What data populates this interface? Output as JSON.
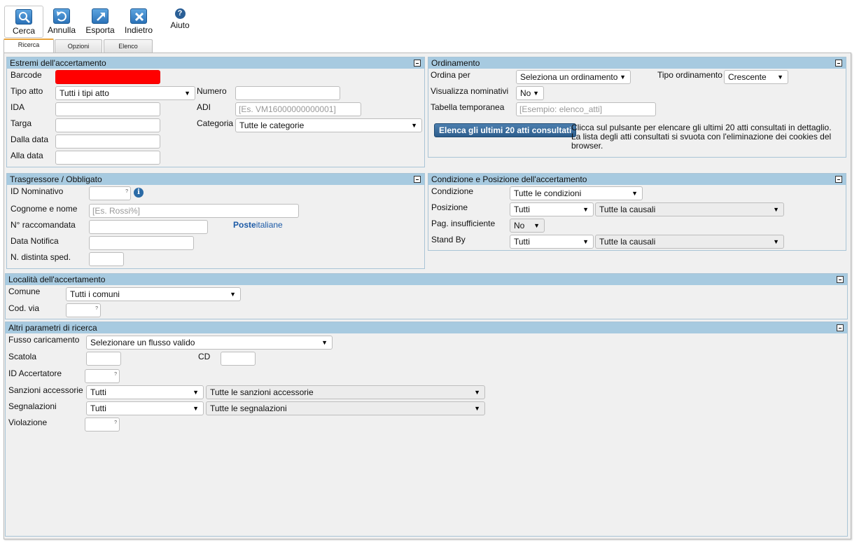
{
  "toolbar": {
    "cerca": "Cerca",
    "annulla": "Annulla",
    "esporta": "Esporta",
    "indietro": "Indietro",
    "aiuto": "Aiuto",
    "help_glyph": "?"
  },
  "tabs": [
    "Ricerca",
    "Opzioni",
    "Elenco"
  ],
  "estremi": {
    "title": "Estremi dell'accertamento",
    "barcode_label": "Barcode",
    "tipo_atto_label": "Tipo atto",
    "tipo_atto_value": "Tutti i tipi atto",
    "numero_label": "Numero",
    "ida_label": "IDA",
    "adi_label": "ADI",
    "adi_placeholder": "[Es. VM16000000000001]",
    "targa_label": "Targa",
    "categoria_label": "Categoria",
    "categoria_value": "Tutte le categorie",
    "dalla_data_label": "Dalla data",
    "alla_data_label": "Alla data"
  },
  "ordinamento": {
    "title": "Ordinamento",
    "ordina_per_label": "Ordina per",
    "ordina_per_value": "Seleziona un ordinamento",
    "tipo_ordinamento_label": "Tipo ordinamento",
    "tipo_ordinamento_value": "Crescente",
    "visualizza_label": "Visualizza nominativi",
    "visualizza_value": "No",
    "tabella_label": "Tabella temporanea",
    "tabella_placeholder": "[Esempio: elenco_atti]",
    "elenca_button": "Elenca gli ultimi 20 atti consultati",
    "elenca_note": "Clicca sul pulsante per elencare gli ultimi 20 atti consultati in dettaglio. La lista degli atti consultati si svuota con l'eliminazione dei cookies del browser."
  },
  "trasgressore": {
    "title": "Trasgressore / Obbligato",
    "id_nominativo_label": "ID Nominativo",
    "cognome_label": "Cognome e nome",
    "cognome_placeholder": "[Es. Rossi%]",
    "raccomandata_label": "N° raccomandata",
    "poste_bold": "Poste",
    "poste_rest": "italiane",
    "data_notifica_label": "Data Notifica",
    "distinta_label": "N. distinta sped."
  },
  "condizione": {
    "title": "Condizione e Posizione dell'accertamento",
    "condizione_label": "Condizione",
    "condizione_value": "Tutte le condizioni",
    "posizione_label": "Posizione",
    "posizione_value": "Tutti",
    "posizione_causali": "Tutte la causali",
    "pag_label": "Pag. insufficiente",
    "pag_value": "No",
    "standby_label": "Stand By",
    "standby_value": "Tutti",
    "standby_causali": "Tutte la causali"
  },
  "localita": {
    "title": "Località dell'accertamento",
    "comune_label": "Comune",
    "comune_value": "Tutti i comuni",
    "cod_via_label": "Cod. via"
  },
  "altri": {
    "title": "Altri parametri di ricerca",
    "flusso_label": "Fusso caricamento",
    "flusso_value": "Selezionare un flusso valido",
    "scatola_label": "Scatola",
    "cd_label": "CD",
    "id_accertatore_label": "ID Accertatore",
    "sanzioni_label": "Sanzioni accessorie",
    "sanzioni_value": "Tutti",
    "sanzioni_detail": "Tutte le sanzioni accessorie",
    "segnalazioni_label": "Segnalazioni",
    "segnalazioni_value": "Tutti",
    "segnalazioni_detail": "Tutte le segnalazioni",
    "violazione_label": "Violazione"
  },
  "colors": {
    "panel_header": "#a7cae0",
    "barcode_fill": "#ff0000",
    "button_blue": "#2d5d8d",
    "tab_accent": "#e8a33c"
  }
}
